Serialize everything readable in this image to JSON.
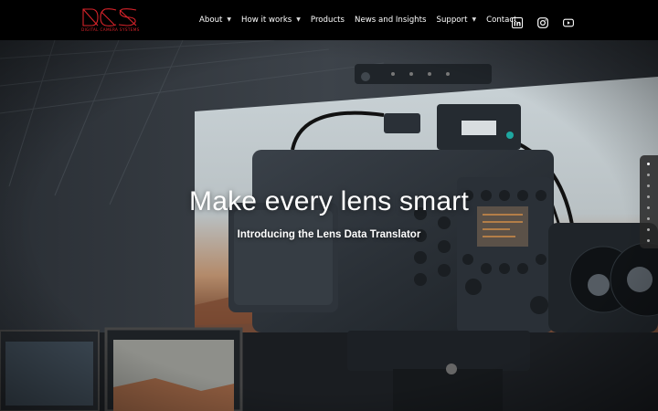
{
  "brand": {
    "name": "DCS",
    "tagline": "DIGITAL CAMERA SYSTEMS",
    "color": "#d8232a"
  },
  "nav": {
    "items": [
      {
        "label": "About",
        "has_dropdown": true
      },
      {
        "label": "How it works",
        "has_dropdown": true
      },
      {
        "label": "Products",
        "has_dropdown": false
      },
      {
        "label": "News and Insights",
        "has_dropdown": false
      },
      {
        "label": "Support",
        "has_dropdown": true
      },
      {
        "label": "Contact",
        "has_dropdown": false
      }
    ],
    "dropdown_icon": "chevron-down-icon",
    "social": [
      "linkedin-icon",
      "instagram-icon",
      "youtube-icon"
    ]
  },
  "hero": {
    "title": "Make every lens smart",
    "subtitle": "Introducing the Lens Data Translator",
    "slide_count": 8,
    "active_slide": 1
  },
  "colors": {
    "nav_bg": "#000000",
    "text": "#ffffff",
    "accent": "#d8232a"
  }
}
